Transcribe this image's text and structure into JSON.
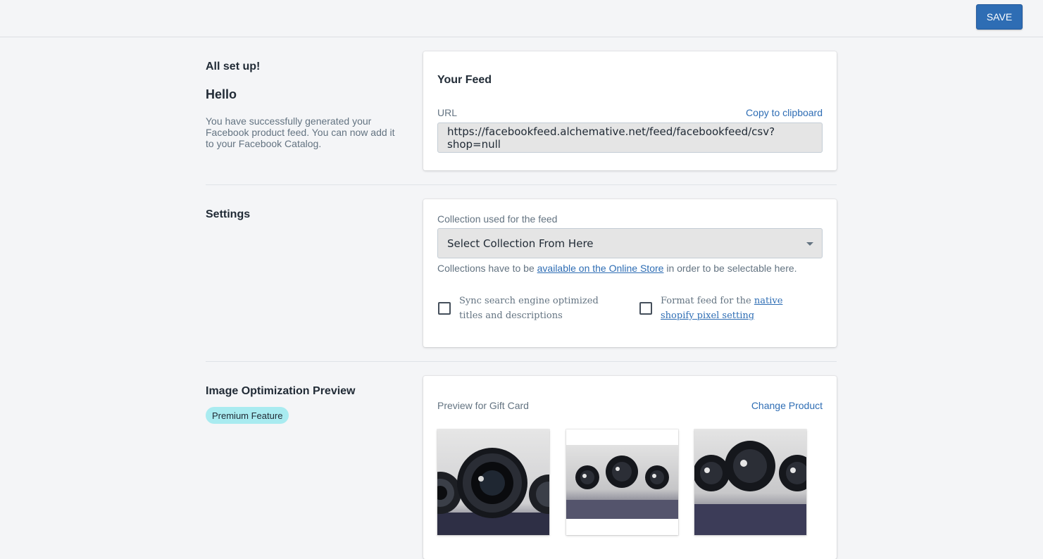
{
  "toolbar": {
    "save_label": "SAVE"
  },
  "setup": {
    "title": "All set up!",
    "hello": "Hello",
    "description": "You have successfully generated your Facebook product feed. You can now add it to your Facebook Catalog."
  },
  "feed": {
    "title": "Your Feed",
    "url_label": "URL",
    "copy_label": "Copy to clipboard",
    "url_value": "https://facebookfeed.alchemative.net/feed/facebookfeed/csv?shop=null"
  },
  "settings": {
    "title": "Settings",
    "collection_label": "Collection used for the feed",
    "collection_selected": "Select Collection From Here",
    "help_prefix": "Collections have to be ",
    "help_link": "available on the Online Store",
    "help_suffix": " in order to be selectable here.",
    "sync_label": "Sync search engine optimized titles and descriptions",
    "sync_checked": false,
    "format_prefix": "Format feed for the ",
    "format_link": "native shopify pixel setting",
    "format_checked": false
  },
  "image_preview": {
    "title": "Image Optimization Preview",
    "badge": "Premium Feature",
    "preview_label": "Preview for Gift Card",
    "change_label": "Change Product",
    "thumbnails": [
      "camera-lenses-square",
      "camera-lenses-padded",
      "camera-lenses-cropped"
    ]
  },
  "colors": {
    "accent": "#2e6db4",
    "badge": "#a9ebf0",
    "background": "#f4f5f7"
  }
}
